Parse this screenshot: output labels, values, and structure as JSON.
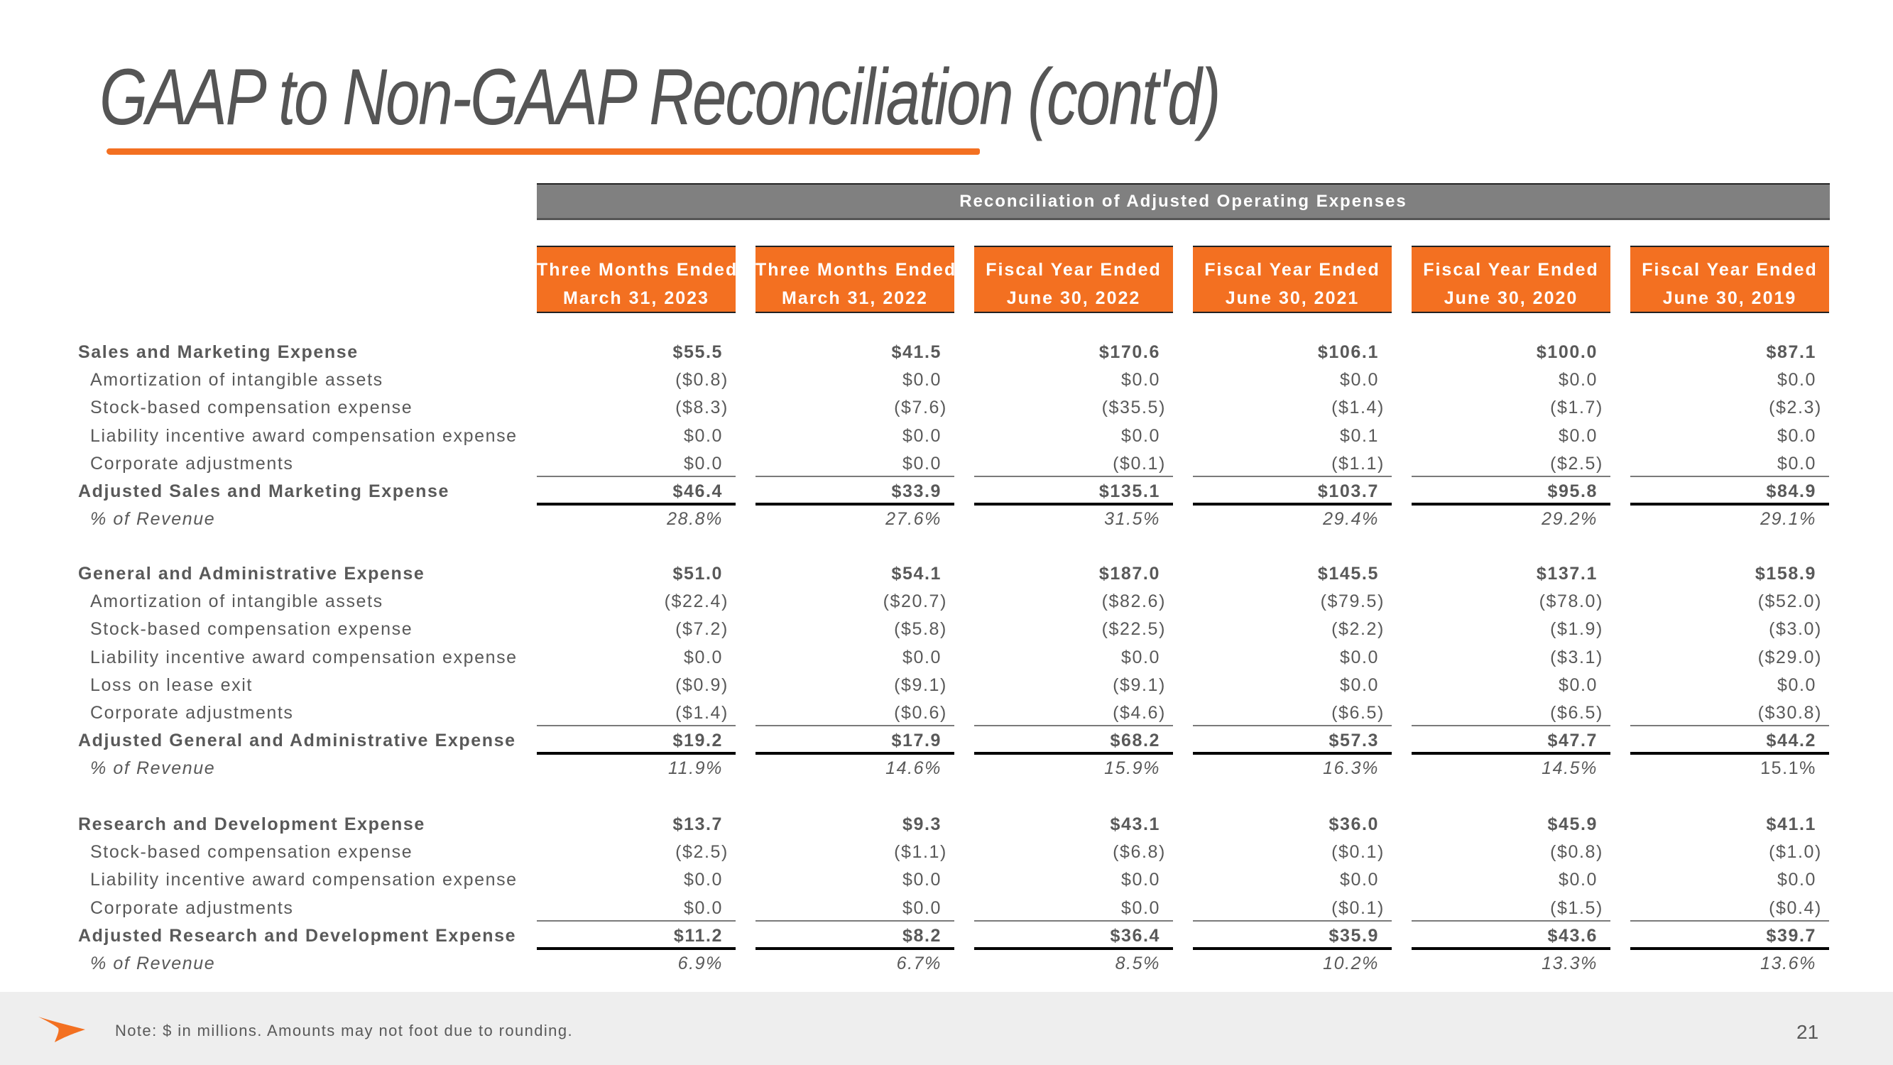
{
  "title": "GAAP to Non-GAAP Reconciliation (cont'd)",
  "table_title": "Reconciliation of Adjusted Operating Expenses",
  "columns": [
    {
      "line1": "Three Months Ended",
      "line2": "March 31, 2023"
    },
    {
      "line1": "Three Months Ended",
      "line2": "March 31, 2022"
    },
    {
      "line1": "Fiscal Year Ended",
      "line2": "June 30, 2022"
    },
    {
      "line1": "Fiscal Year Ended",
      "line2": "June 30, 2021"
    },
    {
      "line1": "Fiscal Year Ended",
      "line2": "June 30, 2020"
    },
    {
      "line1": "Fiscal Year Ended",
      "line2": "June 30, 2019"
    }
  ],
  "sections": [
    {
      "name": "sales-marketing",
      "rows": [
        {
          "label": "Sales and Marketing Expense",
          "type": "header",
          "values": [
            "$55.5",
            "$41.5",
            "$170.6",
            "$106.1",
            "$100.0",
            "$87.1"
          ]
        },
        {
          "label": "Amortization of intangible assets",
          "type": "sub",
          "values": [
            "($0.8)",
            "$0.0",
            "$0.0",
            "$0.0",
            "$0.0",
            "$0.0"
          ]
        },
        {
          "label": "Stock-based compensation expense",
          "type": "sub",
          "values": [
            "($8.3)",
            "($7.6)",
            "($35.5)",
            "($1.4)",
            "($1.7)",
            "($2.3)"
          ]
        },
        {
          "label": "Liability incentive award compensation expense",
          "type": "sub",
          "values": [
            "$0.0",
            "$0.0",
            "$0.0",
            "$0.1",
            "$0.0",
            "$0.0"
          ]
        },
        {
          "label": "Corporate adjustments",
          "type": "sub",
          "values": [
            "$0.0",
            "$0.0",
            "($0.1)",
            "($1.1)",
            "($2.5)",
            "$0.0"
          ]
        },
        {
          "label": "Adjusted Sales and Marketing Expense",
          "type": "total",
          "values": [
            "$46.4",
            "$33.9",
            "$135.1",
            "$103.7",
            "$95.8",
            "$84.9"
          ]
        },
        {
          "label": "% of Revenue",
          "type": "pct",
          "values": [
            "28.8%",
            "27.6%",
            "31.5%",
            "29.4%",
            "29.2%",
            "29.1%"
          ]
        }
      ]
    },
    {
      "name": "general-administrative",
      "rows": [
        {
          "label": "General and Administrative Expense",
          "type": "header",
          "values": [
            "$51.0",
            "$54.1",
            "$187.0",
            "$145.5",
            "$137.1",
            "$158.9"
          ]
        },
        {
          "label": "Amortization of intangible assets",
          "type": "sub",
          "values": [
            "($22.4)",
            "($20.7)",
            "($82.6)",
            "($79.5)",
            "($78.0)",
            "($52.0)"
          ]
        },
        {
          "label": "Stock-based compensation expense",
          "type": "sub",
          "values": [
            "($7.2)",
            "($5.8)",
            "($22.5)",
            "($2.2)",
            "($1.9)",
            "($3.0)"
          ]
        },
        {
          "label": "Liability incentive award compensation expense",
          "type": "sub",
          "values": [
            "$0.0",
            "$0.0",
            "$0.0",
            "$0.0",
            "($3.1)",
            "($29.0)"
          ]
        },
        {
          "label": "Loss on lease exit",
          "type": "sub",
          "values": [
            "($0.9)",
            "($9.1)",
            "($9.1)",
            "$0.0",
            "$0.0",
            "$0.0"
          ]
        },
        {
          "label": "Corporate adjustments",
          "type": "sub",
          "values": [
            "($1.4)",
            "($0.6)",
            "($4.6)",
            "($6.5)",
            "($6.5)",
            "($30.8)"
          ]
        },
        {
          "label": "Adjusted General and Administrative Expense",
          "type": "total",
          "values": [
            "$19.2",
            "$17.9",
            "$68.2",
            "$57.3",
            "$47.7",
            "$44.2"
          ]
        },
        {
          "label": "% of Revenue",
          "type": "pct",
          "values": [
            "11.9%",
            "14.6%",
            "15.9%",
            "16.3%",
            "14.5%",
            "15.1%"
          ]
        }
      ]
    },
    {
      "name": "research-development",
      "rows": [
        {
          "label": "Research and Development Expense",
          "type": "header",
          "values": [
            "$13.7",
            "$9.3",
            "$43.1",
            "$36.0",
            "$45.9",
            "$41.1"
          ]
        },
        {
          "label": "Stock-based compensation expense",
          "type": "sub",
          "values": [
            "($2.5)",
            "($1.1)",
            "($6.8)",
            "($0.1)",
            "($0.8)",
            "($1.0)"
          ]
        },
        {
          "label": "Liability incentive award compensation expense",
          "type": "sub",
          "values": [
            "$0.0",
            "$0.0",
            "$0.0",
            "$0.0",
            "$0.0",
            "$0.0"
          ]
        },
        {
          "label": "Corporate adjustments",
          "type": "sub",
          "values": [
            "$0.0",
            "$0.0",
            "$0.0",
            "($0.1)",
            "($1.5)",
            "($0.4)"
          ]
        },
        {
          "label": "Adjusted Research and Development Expense",
          "type": "total",
          "values": [
            "$11.2",
            "$8.2",
            "$36.4",
            "$35.9",
            "$43.6",
            "$39.7"
          ]
        },
        {
          "label": "% of Revenue",
          "type": "pct",
          "values": [
            "6.9%",
            "6.7%",
            "8.5%",
            "10.2%",
            "13.3%",
            "13.6%"
          ]
        }
      ]
    }
  ],
  "footer": {
    "note": "Note: $ in millions. Amounts may not foot due to rounding.",
    "page_number": "21",
    "icon": "arrow-logo-icon"
  },
  "colors": {
    "accent": "#F37021",
    "band": "#808080",
    "text": "#595959",
    "footer_bg": "#EEEEEE"
  }
}
